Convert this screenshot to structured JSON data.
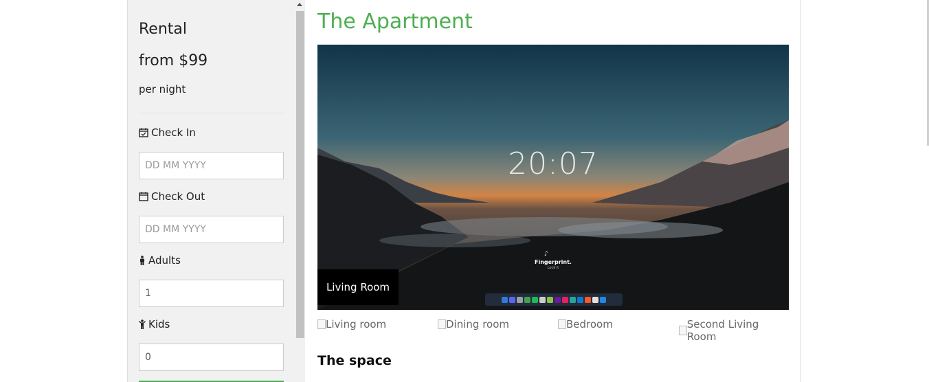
{
  "sidebar": {
    "rental_label": "Rental",
    "price_text": "from $99",
    "per_night": "per night",
    "checkin_label": "Check In",
    "checkin_placeholder": "DD MM YYYY",
    "checkout_label": "Check Out",
    "checkout_placeholder": "DD MM YYYY",
    "adults_label": "Adults",
    "adults_value": "1",
    "kids_label": "Kids",
    "kids_value": "0"
  },
  "main": {
    "title": "The Apartment",
    "hero": {
      "clock": "20:07",
      "app_name": "Fingerprint.",
      "app_sub": "Lock it",
      "caption": "Living Room"
    },
    "thumbnails": [
      "Living room",
      "Dining room",
      "Bedroom",
      "Second Living Room"
    ],
    "space_heading": "The space"
  },
  "colors": {
    "accent": "#4caf50",
    "sidebar_bg": "#f1f1f1",
    "caption_bg": "#000000"
  },
  "icons": {
    "checkin": "calendar-check-icon",
    "checkout": "calendar-icon",
    "adults": "male-icon",
    "kids": "child-icon"
  }
}
